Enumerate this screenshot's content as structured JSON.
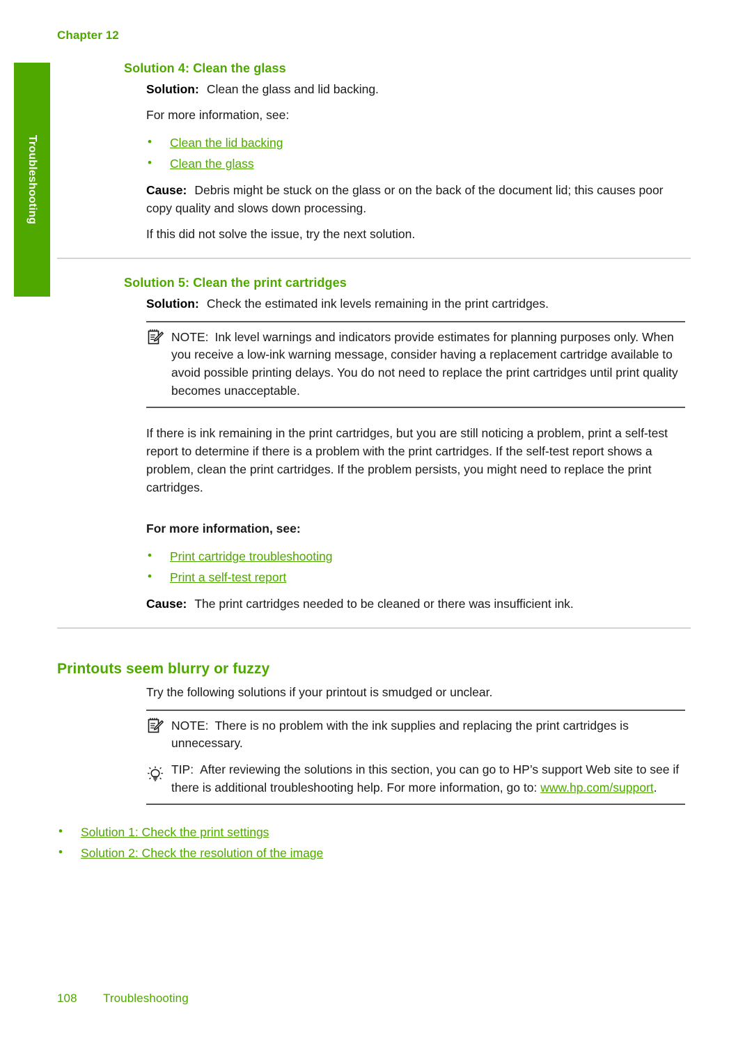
{
  "page": {
    "chapter_header": "Chapter 12",
    "side_tab_label": "Troubleshooting",
    "footer_page_number": "108",
    "footer_section": "Troubleshooting",
    "accent_green": "#4fa800",
    "rule_dark": "#58585a",
    "rule_light": "#d4d4d6"
  },
  "sections": {
    "solution4": {
      "heading": "Solution 4: Clean the glass",
      "solution_label": "Solution:",
      "solution_text": "Clean the glass and lid backing.",
      "for_more_info": "For more information, see:",
      "links": [
        "Clean the lid backing",
        "Clean the glass"
      ],
      "cause_label": "Cause:",
      "cause_text": "Debris might be stuck on the glass or on the back of the document lid; this causes poor copy quality and slows down processing.",
      "next_solution": "If this did not solve the issue, try the next solution."
    },
    "solution5": {
      "heading": "Solution 5: Clean the print cartridges",
      "solution_label": "Solution:",
      "solution_text": "Check the estimated ink levels remaining in the print cartridges.",
      "note": {
        "icon": "note-pad-pencil-icon",
        "keyword": "NOTE:",
        "text": "Ink level warnings and indicators provide estimates for planning purposes only. When you receive a low-ink warning message, consider having a replacement cartridge available to avoid possible printing delays. You do not need to replace the print cartridges until print quality becomes unacceptable."
      },
      "paragraph": "If there is ink remaining in the print cartridges, but you are still noticing a problem, print a self-test report to determine if there is a problem with the print cartridges. If the self-test report shows a problem, clean the print cartridges. If the problem persists, you might need to replace the print cartridges.",
      "for_more_info": "For more information, see:",
      "links": [
        "Print cartridge troubleshooting",
        "Print a self-test report"
      ],
      "cause_label": "Cause:",
      "cause_text": "The print cartridges needed to be cleaned or there was insufficient ink."
    },
    "blurry": {
      "heading": "Printouts seem blurry or fuzzy",
      "intro": "Try the following solutions if your printout is smudged or unclear.",
      "note": {
        "icon": "note-pad-pencil-icon",
        "keyword": "NOTE:",
        "text": "There is no problem with the ink supplies and replacing the print cartridges is unnecessary."
      },
      "tip": {
        "icon": "lightbulb-icon",
        "keyword": "TIP:",
        "text_before_link": "After reviewing the solutions in this section, you can go to HP’s support Web site to see if there is additional troubleshooting help. For more information, go to:",
        "link": "www.hp.com/support",
        "text_after_link": "."
      },
      "links": [
        "Solution 1: Check the print settings",
        "Solution 2: Check the resolution of the image"
      ]
    }
  }
}
